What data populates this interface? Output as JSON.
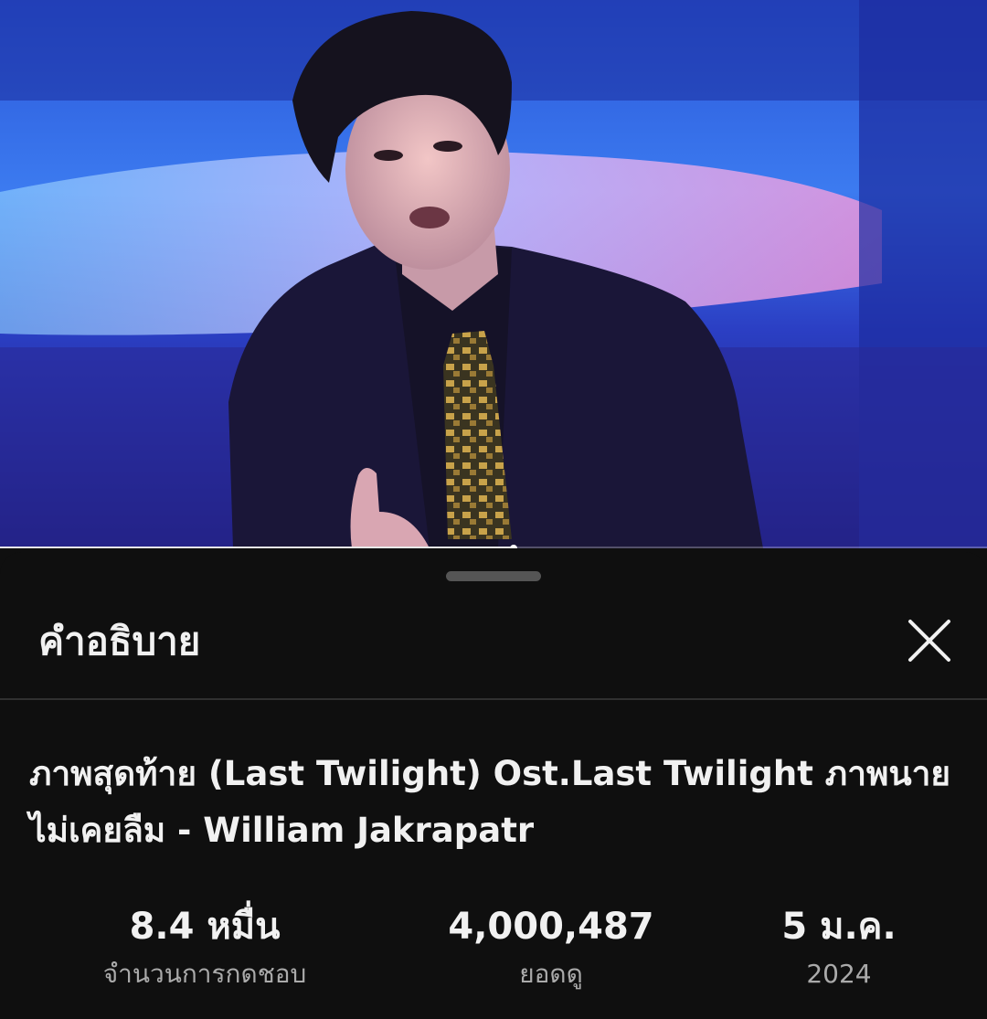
{
  "video": {
    "thumbnail": "music-video-frame-singer",
    "progress_percent": 52
  },
  "sheet": {
    "title": "คำอธิบาย",
    "close_icon": "close-icon"
  },
  "description": {
    "video_title": "ภาพสุดท้าย (Last Twilight) Ost.Last Twilight ภาพนายไม่เคยลืม - William Jakrapatr",
    "stats": {
      "likes_value": "8.4 หมื่น",
      "likes_label": "จำนวนการกดชอบ",
      "views_value": "4,000,487",
      "views_label": "ยอดดู",
      "date_value": "5 ม.ค.",
      "date_label": "2024"
    }
  },
  "colors": {
    "background": "#0f0f0f",
    "text_primary": "#f1f1f1",
    "text_secondary": "#aaaaaa",
    "divider": "#303030",
    "handle": "#555555"
  }
}
